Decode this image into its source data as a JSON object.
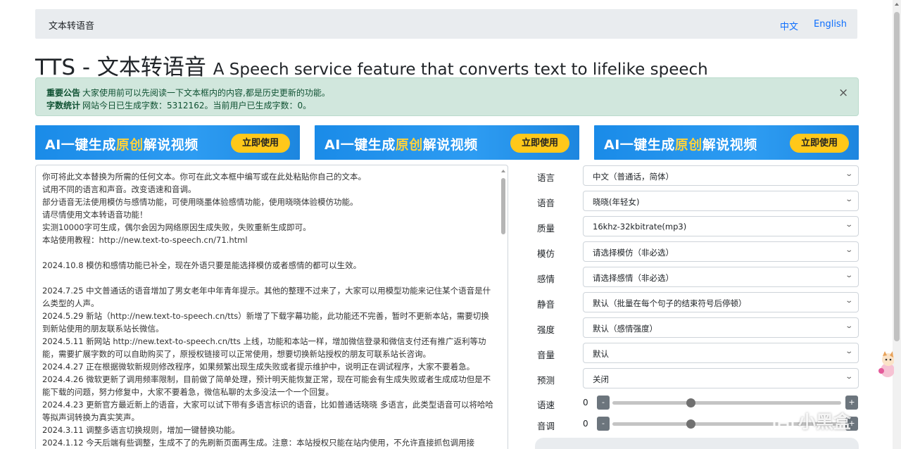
{
  "navbar": {
    "brand": "文本转语音",
    "links": [
      "中文",
      "English"
    ]
  },
  "header": {
    "title": "TTS - 文本转语音",
    "subtitle": "A Speech service feature that converts text to lifelike speech"
  },
  "alert": {
    "notice_label": "重要公告",
    "notice_text": "大家使用前可以先阅读一下文本框内的内容,都是历史更新的功能。",
    "stats_label": "字数统计",
    "stats_text": "网站今日已生成字数：5312162。当前用户已生成字数：0。",
    "close": "×"
  },
  "banners": [
    {
      "text_a": "AI一键生成",
      "text_hl": "原创",
      "text_b": "解说视频",
      "button": "立即使用"
    },
    {
      "text_a": "AI一键生成",
      "text_hl": "原创",
      "text_b": "解说视频",
      "button": "立即使用"
    },
    {
      "text_a": "AI一键生成",
      "text_hl": "原创",
      "text_b": "解说视频",
      "button": "立即使用"
    }
  ],
  "textarea": {
    "lines": [
      "你可将此文本替换为所需的任何文本。你可在此文本框中编写或在此处粘贴你自己的文本。",
      "试用不同的语言和声音。改变语速和音调。",
      "部分语音无法使用模仿与感情功能，可使用晓墨体验感情功能，使用晓晓体验模仿功能。",
      "请尽情使用文本转语音功能！",
      "实测10000字可生成，偶尔会因为网络原因生成失败，失败重新生成即可。",
      "本站使用教程：http://new.text-to-speech.cn/71.html",
      "",
      "2024.10.8 模仿和感情功能已补全，现在外语只要是能选择模仿或者感情的都可以生效。",
      "",
      "2024.7.25 中文普通话的语音增加了男女老年中年青年提示。其他的整理不过来了，大家可以用模型功能来记住某个语音是什么类型的人声。",
      "2024.5.29 新站（http://new.text-to-speech.cn/tts）新增了下载字幕功能，此功能还不完善，暂时不更新本站，需要切换到新站使用的朋友联系站长微信。",
      "2024.5.11 新网站 http://new.text-to-speech.cn/tts 上线，功能和本站一样，增加微信登录和微信支付还有推广返利等功能，需要扩展字数的可以自助购买了，原授权链接可以正常使用，想要切换新站授权的朋友可联系站长咨询。",
      "2024.4.27 正在根据微软新规则修改程序，如果频繁出现生成失败或者提示维护中，说明正在调试程序，大家不要着急。",
      "2024.4.26 微软更新了调用频率限制，目前做了简单处理，预计明天能恢复正常，现在可能会有生成失败或者生成成功但是不能下载的问题，努力修复中，大家不要着急，微信私聊的太多没法一个一个回复。",
      "2024.4.23 更新官方最近新上的语音，大家可以试下带有多语言标识的语音，比如普通话晓晓 多语言，此类型语音可以将哈哈等拟声词转换为真实笑声。",
      "2024.3.11 调整多语言切换规则，增加一键替换功能。",
      "2024.1.12 今天后端有些调整，生成不了的先刷新页面再生成。注意：本站授权只能在站内使用，不允许直接抓包调用接"
    ]
  },
  "form": {
    "rows": [
      {
        "label": "语言",
        "value": "中文（普通话，简体）"
      },
      {
        "label": "语音",
        "value": "晓晓(年轻女)"
      },
      {
        "label": "质量",
        "value": "16khz-32kbitrate(mp3)"
      },
      {
        "label": "模仿",
        "value": "请选择模仿（非必选）"
      },
      {
        "label": "感情",
        "value": "请选择感情（非必选）"
      },
      {
        "label": "静音",
        "value": "默认（批量在每个句子的结束符号后停顿）"
      },
      {
        "label": "强度",
        "value": "默认（感情强度）"
      },
      {
        "label": "音量",
        "value": "默认"
      },
      {
        "label": "预测",
        "value": "关闭"
      }
    ],
    "sliders": [
      {
        "label": "语速",
        "value": "0",
        "minus": "-",
        "plus": "+",
        "level": 0.34
      },
      {
        "label": "音调",
        "value": "0",
        "minus": "-",
        "plus": "+",
        "level": 0.34
      }
    ]
  },
  "watermark": {
    "text": "小黑盒"
  },
  "icons": {
    "close": "close-icon",
    "chevron": "chevron-down-icon",
    "mascot": "mascot-icon",
    "watermark_logo": "heybox-logo-icon"
  },
  "colors": {
    "accent": "#0d6efd",
    "alert_bg": "#d1e7dd",
    "alert_text": "#0f5132",
    "banner_blue": "#1a8be8",
    "banner_button": "#ffc81a",
    "slider_button": "#6c757d"
  }
}
